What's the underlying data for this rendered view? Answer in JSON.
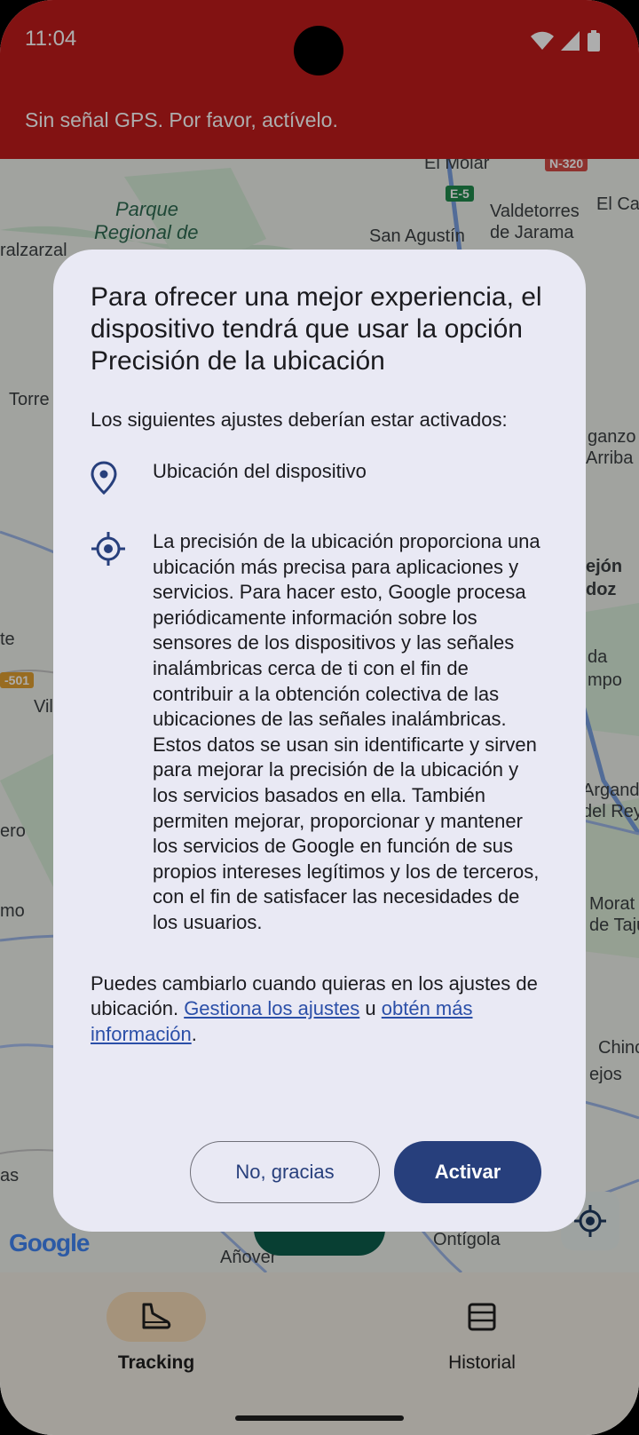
{
  "status_bar": {
    "time": "11:04"
  },
  "banner": {
    "text": "Sin señal GPS. Por favor, actívelo."
  },
  "map": {
    "labels": [
      "El Molar",
      "Valdetorres",
      "de Jarama",
      "El Ca",
      "Parque",
      "Regional de",
      "San Agustín",
      "ralzarzal",
      "Torre",
      "ganzo",
      "Arriba",
      "ejón",
      "doz",
      "da",
      "mpo",
      "Vil",
      "ero",
      "Arganda",
      "del Rey",
      "mo",
      "Morat",
      "de Taju",
      "Chinc",
      "ejos",
      "as",
      "Ontígola",
      "Añover",
      "te"
    ],
    "road_badges": [
      "N-320",
      "E-5",
      "-501"
    ],
    "logo": "Google"
  },
  "dialog": {
    "title": "Para ofrecer una mejor experiencia, el dispositivo tendrá que usar la opción Precisión de la ubicación",
    "intro": "Los siguientes ajustes deberían estar activados:",
    "settings": [
      {
        "icon": "location-pin-icon",
        "text": "Ubicación del dispositivo"
      },
      {
        "icon": "gps-target-icon",
        "text": "La precisión de la ubicación proporciona una ubicación más precisa para aplicaciones y servicios. Para hacer esto, Google procesa periódicamente información sobre los sensores de los dispositivos y las señales inalámbricas cerca de ti con el fin de contribuir a la obtención colectiva de las ubicaciones de las señales inalámbricas. Estos datos se usan sin identificarte y sirven para mejorar la precisión de la ubicación y los servicios basados en ella. También permiten mejorar, proporcionar y mantener los servicios de Google en función de sus propios intereses legítimos y los de terceros, con el fin de satisfacer las necesidades de los usuarios."
      }
    ],
    "footer_prefix": "Puedes cambiarlo cuando quieras en los ajustes de ubicación. ",
    "manage_link": "Gestiona los ajustes",
    "footer_middle": " u ",
    "info_link": "obtén más información",
    "footer_suffix": ".",
    "cancel_label": "No, gracias",
    "confirm_label": "Activar"
  },
  "bottom_nav": {
    "items": [
      {
        "label": "Tracking",
        "icon": "shoe-icon",
        "active": true
      },
      {
        "label": "Historial",
        "icon": "list-icon",
        "active": false
      }
    ]
  },
  "colors": {
    "banner": "#c01b1b",
    "primary": "#273f7c",
    "dialog_bg": "#e9e9f4",
    "link": "#2b4fa8",
    "nav_active": "#f4d9b5"
  }
}
